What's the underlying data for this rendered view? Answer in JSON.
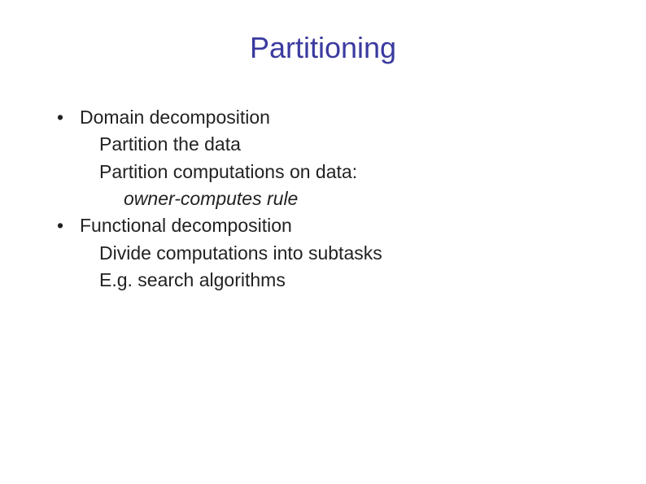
{
  "title": "Partitioning",
  "items": [
    {
      "label": "Domain decomposition",
      "subs": [
        "Partition the data",
        "Partition computations on data:"
      ],
      "note": "owner-computes rule"
    },
    {
      "label": "Functional decomposition",
      "subs": [
        "Divide computations into subtasks",
        "E.g. search algorithms"
      ]
    }
  ],
  "bullet_char": "•"
}
